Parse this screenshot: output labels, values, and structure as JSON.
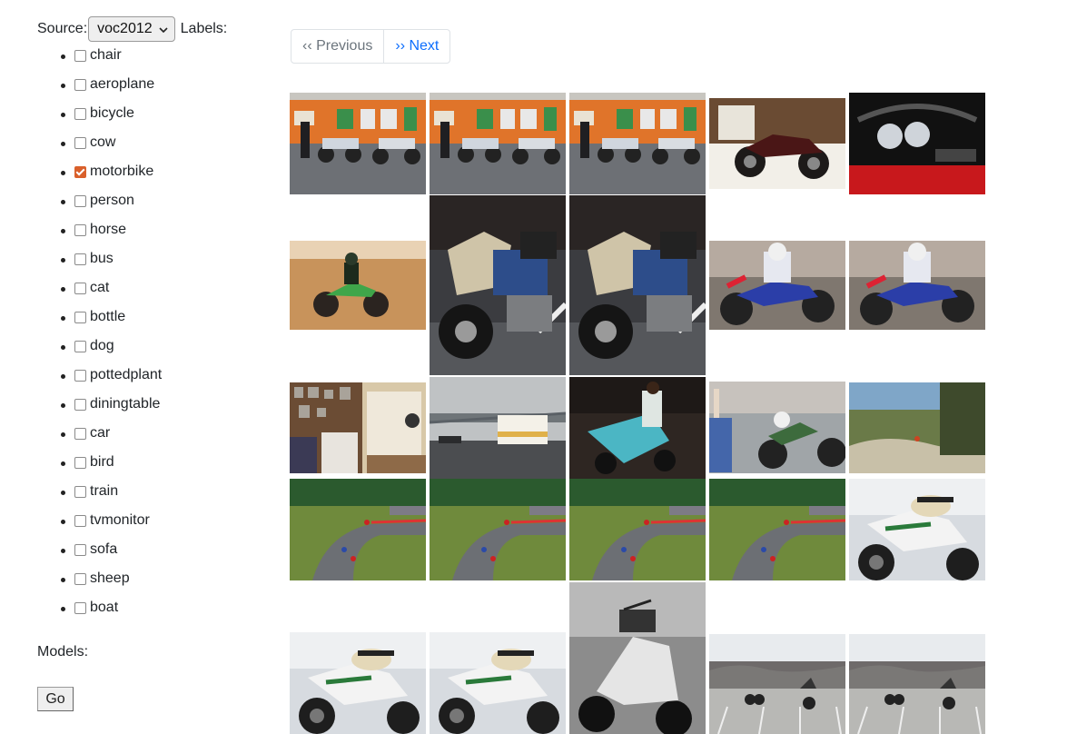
{
  "source": {
    "label": "Source:",
    "selected": "voc2012"
  },
  "labels_heading": "Labels:",
  "labels": [
    {
      "text": "chair",
      "checked": false
    },
    {
      "text": "aeroplane",
      "checked": false
    },
    {
      "text": "bicycle",
      "checked": false
    },
    {
      "text": "cow",
      "checked": false
    },
    {
      "text": "motorbike",
      "checked": true
    },
    {
      "text": "person",
      "checked": false
    },
    {
      "text": "horse",
      "checked": false
    },
    {
      "text": "bus",
      "checked": false
    },
    {
      "text": "cat",
      "checked": false
    },
    {
      "text": "bottle",
      "checked": false
    },
    {
      "text": "dog",
      "checked": false
    },
    {
      "text": "pottedplant",
      "checked": false
    },
    {
      "text": "diningtable",
      "checked": false
    },
    {
      "text": "car",
      "checked": false
    },
    {
      "text": "bird",
      "checked": false
    },
    {
      "text": "train",
      "checked": false
    },
    {
      "text": "tvmonitor",
      "checked": false
    },
    {
      "text": "sofa",
      "checked": false
    },
    {
      "text": "sheep",
      "checked": false
    },
    {
      "text": "boat",
      "checked": false
    }
  ],
  "models_label": "Models:",
  "go_label": "Go",
  "pager": {
    "previous": "‹‹ Previous",
    "next": "›› Next"
  },
  "thumbnails": [
    {
      "scene": "street-bikes"
    },
    {
      "scene": "street-bikes"
    },
    {
      "scene": "street-bikes"
    },
    {
      "scene": "dark-motorbike"
    },
    {
      "scene": "dashboard"
    },
    {
      "scene": "dirt-bike"
    },
    {
      "scene": "touring-bike"
    },
    {
      "scene": "touring-bike"
    },
    {
      "scene": "motocross"
    },
    {
      "scene": "motocross"
    },
    {
      "scene": "room"
    },
    {
      "scene": "bridge-bus"
    },
    {
      "scene": "scooter-woman"
    },
    {
      "scene": "motocross-green"
    },
    {
      "scene": "landscape"
    },
    {
      "scene": "race-track"
    },
    {
      "scene": "race-track"
    },
    {
      "scene": "race-track"
    },
    {
      "scene": "race-track"
    },
    {
      "scene": "police-bike"
    },
    {
      "scene": "police-bike"
    },
    {
      "scene": "police-bike"
    },
    {
      "scene": "bw-scooter"
    },
    {
      "scene": "parking-stunt"
    },
    {
      "scene": "parking-stunt"
    }
  ]
}
